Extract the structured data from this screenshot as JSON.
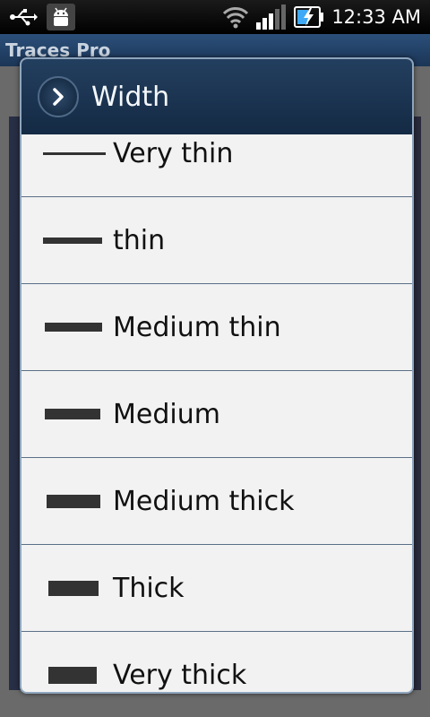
{
  "status_bar": {
    "time": "12:33 AM",
    "icons": [
      "usb-icon",
      "android-debug-icon",
      "wifi-icon",
      "signal-icon",
      "battery-charging-icon"
    ]
  },
  "app": {
    "title": "Traces Pro"
  },
  "dialog": {
    "title": "Width",
    "items": [
      {
        "label": "Very thin"
      },
      {
        "label": "thin"
      },
      {
        "label": "Medium thin"
      },
      {
        "label": "Medium"
      },
      {
        "label": "Medium thick"
      },
      {
        "label": "Thick"
      },
      {
        "label": "Very thick"
      }
    ]
  }
}
